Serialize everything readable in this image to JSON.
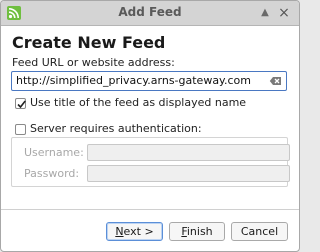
{
  "window": {
    "title": "Add Feed"
  },
  "page": {
    "heading": "Create New Feed"
  },
  "feed_url": {
    "label": "Feed URL or website address:",
    "value": "http://simplified_privacy.arns-gateway.com"
  },
  "options": {
    "use_title_label": "Use title of the feed as displayed name",
    "use_title_checked": true,
    "auth_label": "Server requires authentication:",
    "auth_checked": false
  },
  "auth": {
    "username_label": "Username:",
    "password_label": "Password:"
  },
  "buttons": {
    "next_mnemonic": "N",
    "next_rest": "ext >",
    "finish_mnemonic": "F",
    "finish_rest": "inish",
    "cancel": "Cancel"
  },
  "colors": {
    "accent": "#4a78c2",
    "rss_orange": "#f4891e"
  }
}
